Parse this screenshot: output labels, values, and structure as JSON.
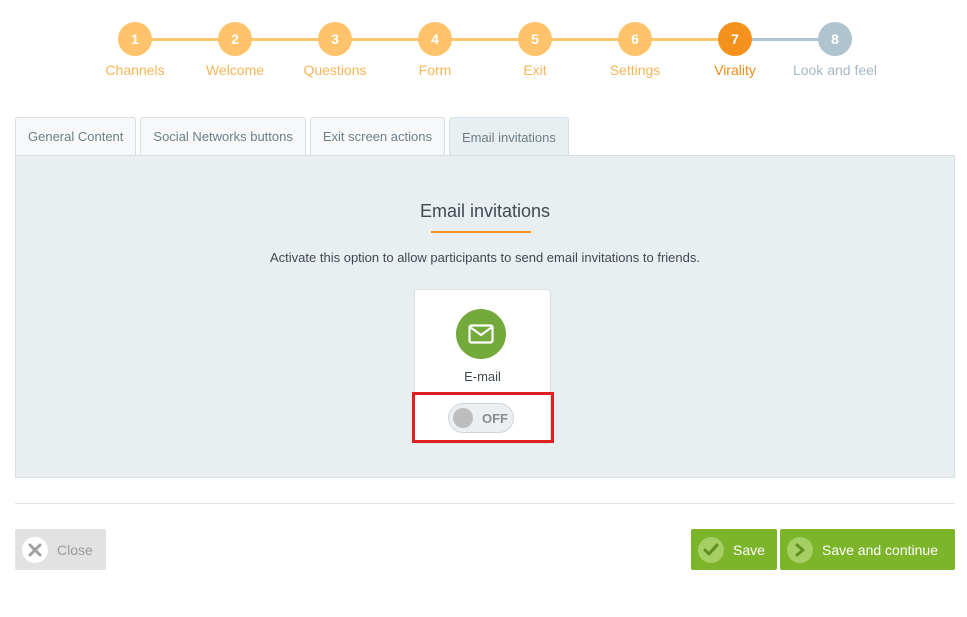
{
  "stepper": {
    "steps": [
      {
        "number": "1",
        "label": "Channels",
        "state": "done"
      },
      {
        "number": "2",
        "label": "Welcome",
        "state": "done"
      },
      {
        "number": "3",
        "label": "Questions",
        "state": "done"
      },
      {
        "number": "4",
        "label": "Form",
        "state": "done"
      },
      {
        "number": "5",
        "label": "Exit",
        "state": "done"
      },
      {
        "number": "6",
        "label": "Settings",
        "state": "done"
      },
      {
        "number": "7",
        "label": "Virality",
        "state": "active"
      },
      {
        "number": "8",
        "label": "Look and feel",
        "state": "todo"
      }
    ],
    "colors": {
      "done": "#ffc46b",
      "active": "#f5921e",
      "todo": "#b0c4d0"
    }
  },
  "tabs": [
    {
      "label": "General Content",
      "active": false
    },
    {
      "label": "Social Networks buttons",
      "active": false
    },
    {
      "label": "Exit screen actions",
      "active": false
    },
    {
      "label": "Email invitations",
      "active": true
    }
  ],
  "panel": {
    "title": "Email invitations",
    "description": "Activate this option to allow participants to send email invitations to friends.",
    "card": {
      "icon": "envelope-icon",
      "label": "E-mail",
      "toggle_state": "OFF"
    }
  },
  "footer": {
    "close_label": "Close",
    "save_label": "Save",
    "save_continue_label": "Save and continue"
  },
  "colors": {
    "accent": "#f5921e",
    "success": "#7cb42a",
    "email_green": "#74a93b",
    "highlight_red": "#e02020"
  }
}
